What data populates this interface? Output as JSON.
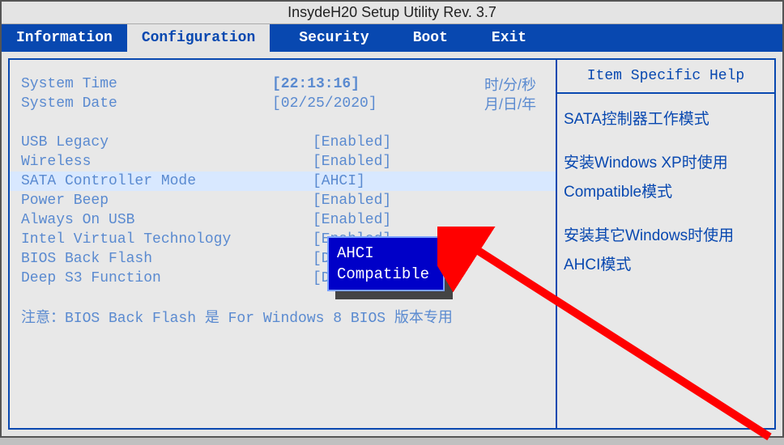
{
  "title": "InsydeH20 Setup Utility Rev. 3.7",
  "tabs": {
    "information": "Information",
    "configuration": "Configuration",
    "security": "Security",
    "boot": "Boot",
    "exit": "Exit"
  },
  "rows": {
    "system_time": {
      "label": "System Time",
      "value": "[22:13:16]",
      "note": "时/分/秒"
    },
    "system_date": {
      "label": "System Date",
      "value": "[02/25/2020]",
      "note": "月/日/年"
    },
    "usb_legacy": {
      "label": "USB Legacy",
      "value": "[Enabled]"
    },
    "wireless": {
      "label": "Wireless",
      "value": "[Enabled]"
    },
    "sata_mode": {
      "label": "SATA Controller Mode",
      "value": "[AHCI]"
    },
    "power_beep": {
      "label": "Power Beep",
      "value": "[Enabled]"
    },
    "always_on_usb": {
      "label": "Always On USB",
      "value": "[Enabled]"
    },
    "intel_vt": {
      "label": "Intel Virtual Technology",
      "value": "[Enabled]"
    },
    "bios_back_flash": {
      "label": "BIOS Back Flash",
      "value": "[Disabled]"
    },
    "deep_s3": {
      "label": "Deep S3 Function",
      "value": "[Disabled]"
    }
  },
  "note_line": "注意：BIOS Back Flash 是 For Windows 8 BIOS 版本专用",
  "popup": {
    "opt1": "AHCI",
    "opt2": "Compatible"
  },
  "help": {
    "header": "Item Specific Help",
    "p1": "SATA控制器工作模式",
    "p2": "安装Windows  XP时使用Compatible模式",
    "p3": "安装其它Windows时使用AHCI模式"
  }
}
